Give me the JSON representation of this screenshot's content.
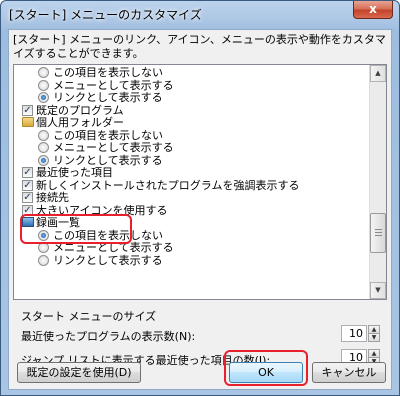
{
  "window": {
    "title": "[スタート] メニューのカスタマイズ",
    "close_label": "x"
  },
  "description": "[スタート] メニューのリンク、アイコン、メニューの表示や動作をカスタマイズすることができます。",
  "list": {
    "items": [
      {
        "kind": "radio",
        "checked": false,
        "label": "この項目を表示しない"
      },
      {
        "kind": "radio",
        "checked": false,
        "label": "メニューとして表示する"
      },
      {
        "kind": "radio",
        "checked": true,
        "label": "リンクとして表示する"
      },
      {
        "kind": "checkbox",
        "checked": true,
        "label": "既定のプログラム"
      },
      {
        "kind": "folder",
        "label": "個人用フォルダー"
      },
      {
        "kind": "radio",
        "checked": false,
        "label": "この項目を表示しない"
      },
      {
        "kind": "radio",
        "checked": false,
        "label": "メニューとして表示する"
      },
      {
        "kind": "radio",
        "checked": true,
        "label": "リンクとして表示する"
      },
      {
        "kind": "checkbox",
        "checked": true,
        "label": "最近使った項目"
      },
      {
        "kind": "checkbox",
        "checked": true,
        "label": "新しくインストールされたプログラムを強調表示する"
      },
      {
        "kind": "checkbox",
        "checked": true,
        "label": "接続先"
      },
      {
        "kind": "checkbox",
        "checked": true,
        "label": "大きいアイコンを使用する"
      },
      {
        "kind": "monitor",
        "label": "録画一覧"
      },
      {
        "kind": "radio",
        "checked": true,
        "label": "この項目を表示しない"
      },
      {
        "kind": "radio",
        "checked": false,
        "label": "メニューとして表示する"
      },
      {
        "kind": "radio",
        "checked": false,
        "label": "リンクとして表示する"
      }
    ],
    "scroll_up": "▲",
    "scroll_down": "▼"
  },
  "size_group": {
    "title": "スタート メニューのサイズ",
    "recent_programs_label": "最近使ったプログラムの表示数(N):",
    "recent_programs_value": "10",
    "jumplist_label": "ジャンプ リストに表示する最近使った項目の数(J):",
    "jumplist_value": "10",
    "spin_up": "▲",
    "spin_down": "▼"
  },
  "buttons": {
    "defaults": "既定の設定を使用(D)",
    "ok": "OK",
    "cancel": "キャンセル"
  },
  "colors": {
    "highlight_red": "#e8202c",
    "default_button_border": "#3c7fb1"
  }
}
